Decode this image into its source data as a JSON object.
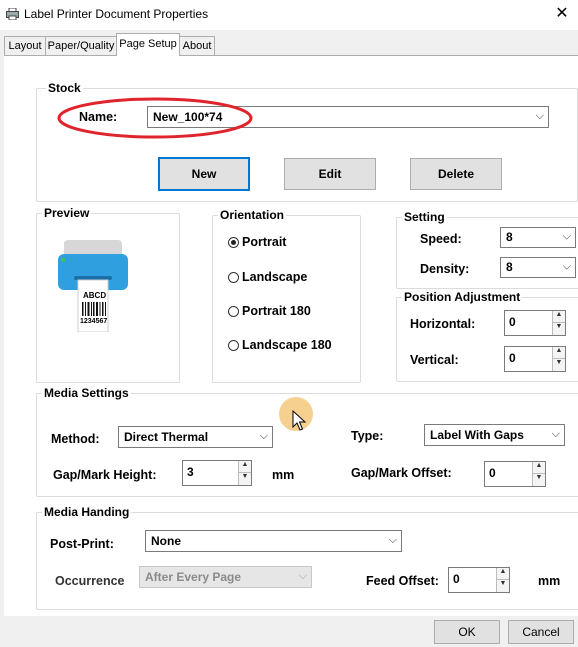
{
  "window": {
    "title": "Label Printer Document Properties",
    "close_glyph": "✕"
  },
  "tabs": [
    {
      "label": "Layout"
    },
    {
      "label": "Paper/Quality"
    },
    {
      "label": "Page Setup"
    },
    {
      "label": "About"
    }
  ],
  "stock": {
    "group_label": "Stock",
    "name_label": "Name:",
    "name_value": "New_100*74",
    "new_button": "New",
    "edit_button": "Edit",
    "delete_button": "Delete",
    "highlight_color": "#e0242b"
  },
  "preview": {
    "group_label": "Preview",
    "sample_text": "ABCD",
    "sample_number": "1234567"
  },
  "orientation": {
    "group_label": "Orientation",
    "options": [
      "Portrait",
      "Landscape",
      "Portrait 180",
      "Landscape 180"
    ],
    "selected": "Portrait"
  },
  "setting": {
    "group_label": "Setting",
    "speed_label": "Speed:",
    "speed_value": "8",
    "density_label": "Density:",
    "density_value": "8"
  },
  "position_adjustment": {
    "group_label": "Position Adjustment",
    "horizontal_label": "Horizontal:",
    "horizontal_value": "0",
    "vertical_label": "Vertical:",
    "vertical_value": "0"
  },
  "media_settings": {
    "group_label": "Media Settings",
    "method_label": "Method:",
    "method_value": "Direct Thermal",
    "type_label": "Type:",
    "type_value": "Label With Gaps",
    "gap_height_label": "Gap/Mark Height:",
    "gap_height_value": "3",
    "gap_height_unit": "mm",
    "gap_offset_label": "Gap/Mark Offset:",
    "gap_offset_value": "0"
  },
  "media_handing": {
    "group_label": "Media Handing",
    "post_print_label": "Post-Print:",
    "post_print_value": "None",
    "occurrence_label": "Occurrence",
    "occurrence_value": "After Every Page",
    "feed_offset_label": "Feed Offset:",
    "feed_offset_value": "0",
    "feed_offset_unit": "mm"
  },
  "footer": {
    "ok_button": "OK",
    "cancel_button": "Cancel"
  },
  "cursor_highlight_color": "#f5c87a"
}
